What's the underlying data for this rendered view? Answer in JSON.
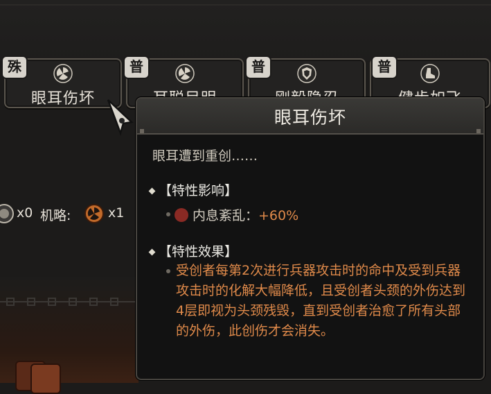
{
  "traits": [
    {
      "tag": "殊",
      "name": "眼耳伤坏",
      "icon": "fan-icon"
    },
    {
      "tag": "普",
      "name": "耳聪目明",
      "icon": "fan-icon"
    },
    {
      "tag": "普",
      "name": "刚毅隐忍",
      "icon": "shield-icon"
    },
    {
      "tag": "普",
      "name": "健步如飞",
      "icon": "boot-icon"
    }
  ],
  "resources": {
    "first_count": "x0",
    "strategy_label": "机略:",
    "strategy_count": "x1"
  },
  "tooltip": {
    "title": "眼耳伤坏",
    "description": "眼耳遭到重创……",
    "influence_header": "【特性影响】",
    "influence_stat_label": "内息紊乱：",
    "influence_stat_value": "+60%",
    "effect_header": "【特性效果】",
    "effect_text": "受创者每第2次进行兵器攻击时的命中及受到兵器攻击时的化解大幅降低，且受创者头颈的外伤达到4层即视为头颈残毁，直到受创者治愈了所有头部的外伤，此创伤才会消失。"
  },
  "colors": {
    "accent_orange": "#e08a4a",
    "tooltip_bg": "#121212",
    "tag_bg": "#d7d3cb"
  }
}
